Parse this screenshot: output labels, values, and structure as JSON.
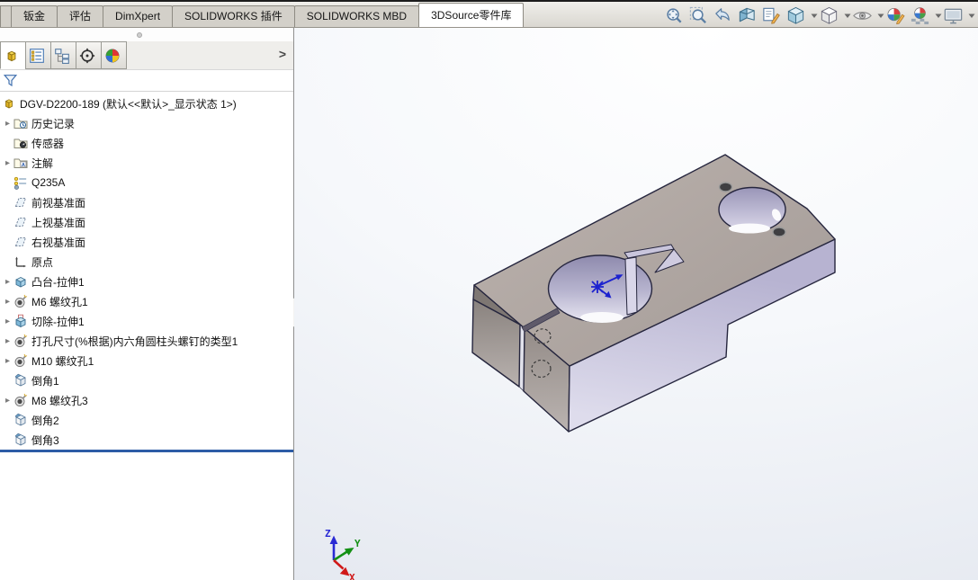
{
  "ribbon": {
    "tabs": [
      {
        "label": "钣金",
        "active": false
      },
      {
        "label": "评估",
        "active": false
      },
      {
        "label": "DimXpert",
        "active": false
      },
      {
        "label": "SOLIDWORKS 插件",
        "active": false
      },
      {
        "label": "SOLIDWORKS MBD",
        "active": false
      },
      {
        "label": "3DSource零件库",
        "active": true
      }
    ]
  },
  "headsup_toolbar": {
    "items": [
      {
        "name": "zoom-to-fit",
        "dropdown": false
      },
      {
        "name": "zoom-to-area",
        "dropdown": false
      },
      {
        "name": "previous-view",
        "dropdown": false
      },
      {
        "name": "section-view",
        "dropdown": false
      },
      {
        "name": "annotation-view",
        "dropdown": false
      },
      {
        "name": "view-orientation",
        "dropdown": true
      },
      {
        "name": "display-style",
        "dropdown": true
      },
      {
        "name": "hide-show-items",
        "dropdown": true
      },
      {
        "name": "edit-appearance",
        "dropdown": false
      },
      {
        "name": "apply-scene",
        "dropdown": true
      },
      {
        "name": "view-settings",
        "dropdown": true
      }
    ]
  },
  "manager_panel": {
    "tabs": [
      {
        "name": "featuremanager-design-tree",
        "icon": "mgr-feature",
        "active": true
      },
      {
        "name": "propertymanager",
        "icon": "mgr-property",
        "active": false
      },
      {
        "name": "configurationmanager",
        "icon": "mgr-config",
        "active": false
      },
      {
        "name": "dimxpertmanager",
        "icon": "mgr-dimxpert",
        "active": false
      },
      {
        "name": "displaymanager",
        "icon": "mgr-display",
        "active": false
      }
    ],
    "collapse_chevron": ">",
    "tree": {
      "root_label": "DGV-D2200-189 (默认<<默认>_显示状态 1>)",
      "items": [
        {
          "label": "历史记录",
          "icon": "history-folder",
          "expandable": true
        },
        {
          "label": "传感器",
          "icon": "sensors-folder",
          "expandable": false
        },
        {
          "label": "注解",
          "icon": "annotations-folder",
          "expandable": true
        },
        {
          "label": "Q235A",
          "icon": "material",
          "expandable": false
        },
        {
          "label": "前视基准面",
          "icon": "plane",
          "expandable": false
        },
        {
          "label": "上视基准面",
          "icon": "plane",
          "expandable": false
        },
        {
          "label": "右视基准面",
          "icon": "plane",
          "expandable": false
        },
        {
          "label": "原点",
          "icon": "origin",
          "expandable": false
        },
        {
          "label": "凸台-拉伸1",
          "icon": "boss-extrude",
          "expandable": true
        },
        {
          "label": "M6 螺纹孔1",
          "icon": "tapped-hole",
          "expandable": true
        },
        {
          "label": "切除-拉伸1",
          "icon": "cut-extrude",
          "expandable": true
        },
        {
          "label": "打孔尺寸(%根据)内六角圆柱头螺钉的类型1",
          "icon": "tapped-hole",
          "expandable": true
        },
        {
          "label": "M10 螺纹孔1",
          "icon": "tapped-hole",
          "expandable": true
        },
        {
          "label": "倒角1",
          "icon": "chamfer",
          "expandable": false
        },
        {
          "label": "M8 螺纹孔3",
          "icon": "tapped-hole",
          "expandable": true
        },
        {
          "label": "倒角2",
          "icon": "chamfer",
          "expandable": false
        },
        {
          "label": "倒角3",
          "icon": "chamfer",
          "expandable": false
        }
      ]
    },
    "rollback_bar_color": "#2d5ca6"
  },
  "viewport": {
    "model_colors": {
      "top_face": "#b1a8a4",
      "front_face_light": "#cbc8e0",
      "sw_face_dark": "#a59c98",
      "edge": "#26263e",
      "origin_marker": "#1c22cf"
    },
    "triad": {
      "axes": [
        {
          "label": "Z",
          "color": "#2a2ad4"
        },
        {
          "label": "Y",
          "color": "#149014"
        },
        {
          "label": "X",
          "color": "#d01818"
        }
      ]
    }
  }
}
